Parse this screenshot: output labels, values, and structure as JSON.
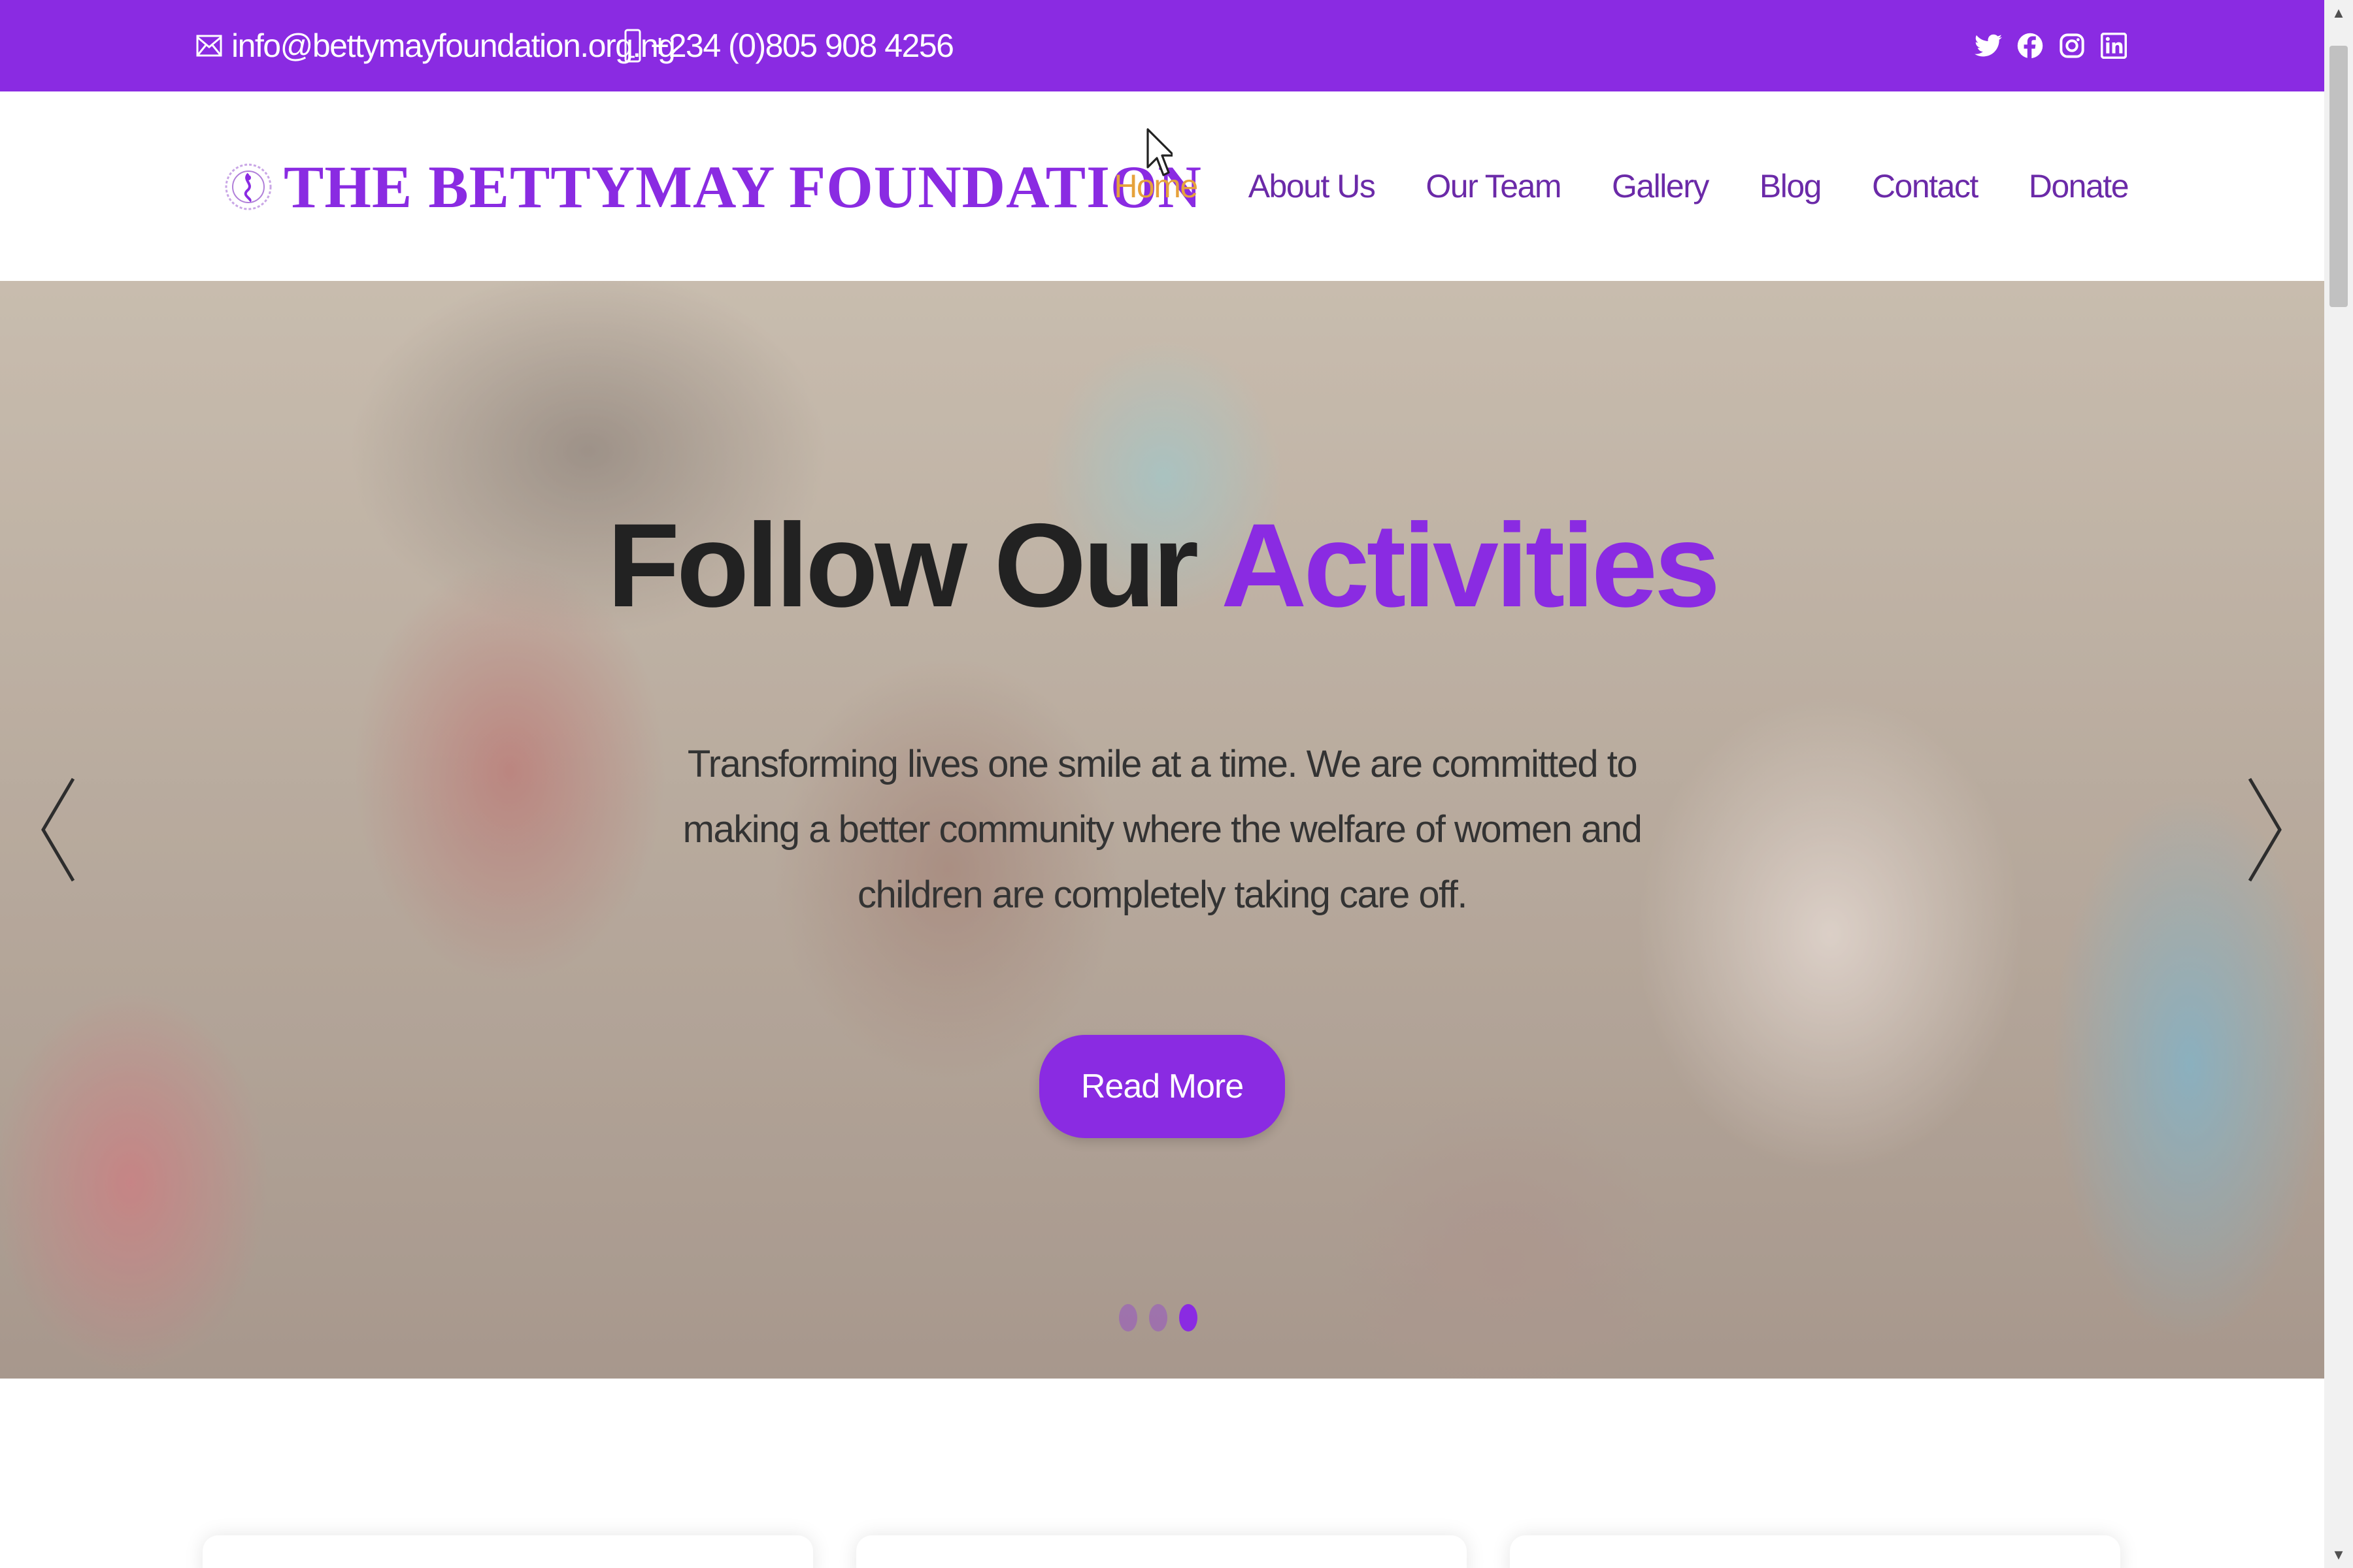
{
  "topbar": {
    "email": "info@bettymayfoundation.org.ng",
    "phone": "+234 (0)805 908 4256",
    "socials": [
      "twitter-icon",
      "facebook-icon",
      "instagram-icon",
      "linkedin-icon"
    ]
  },
  "header": {
    "brand": "THE BETTYMAY FOUNDATION",
    "nav": [
      {
        "label": "Home",
        "active": true
      },
      {
        "label": "About Us"
      },
      {
        "label": "Our Team"
      },
      {
        "label": "Gallery"
      },
      {
        "label": "Blog"
      },
      {
        "label": "Contact"
      },
      {
        "label": "Donate"
      }
    ]
  },
  "hero": {
    "title_main": "Follow Our",
    "title_accent": "Activities",
    "text": "Transforming lives one smile at a time. We are committed to making a better community where the welfare of women and children are completely taking care off.",
    "button": "Read More",
    "slide_count": 3,
    "active_slide": 3
  },
  "colors": {
    "brand_purple": "#8a2be2",
    "nav_active": "#e6a23c",
    "nav_text": "#6b2aa8"
  }
}
